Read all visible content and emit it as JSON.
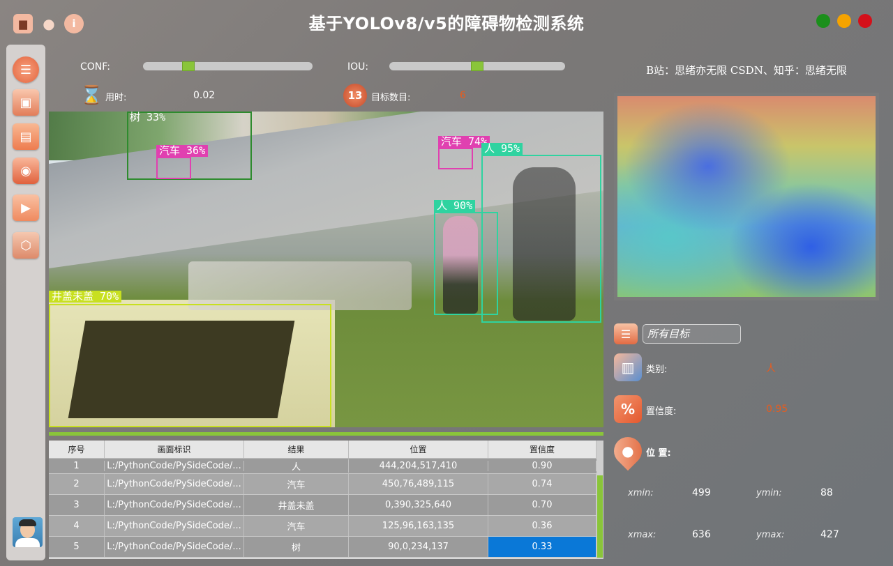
{
  "app": {
    "title": "基于YOLOv8/v5的障碍物检测系统"
  },
  "toolbar": {
    "save_icon": "save-icon",
    "user_icon": "user-icon",
    "info_icon": "info-icon"
  },
  "window_controls": {
    "maximize_color": "#1b8f1b",
    "minimize_color": "#f5a300",
    "close_color": "#d4101a"
  },
  "sidebar": {
    "items": [
      {
        "name": "menu",
        "icon": "list-icon",
        "glyph": "☰"
      },
      {
        "name": "image",
        "icon": "image-icon",
        "glyph": "▣"
      },
      {
        "name": "folder",
        "icon": "folder-icon",
        "glyph": "▤"
      },
      {
        "name": "camera",
        "icon": "camera-icon",
        "glyph": "◉"
      },
      {
        "name": "video",
        "icon": "play-icon",
        "glyph": "▶"
      },
      {
        "name": "model",
        "icon": "cube-icon",
        "glyph": "⬡"
      }
    ]
  },
  "controls": {
    "conf_label": "CONF:",
    "conf_value": 0.25,
    "iou_label": "IOU:",
    "iou_value": 0.5,
    "time_label": "用时:",
    "time_value": "0.02",
    "count_label": "目标数目:",
    "count_value": "6",
    "count_badge": "13"
  },
  "detections": [
    {
      "label": "树 33%",
      "color": "#2e8b2e",
      "text_color": "#ffffff"
    },
    {
      "label": "汽车 36%",
      "color": "#e040b0",
      "text_color": "#ffffff"
    },
    {
      "label": "汽车 74%",
      "color": "#e040b0",
      "text_color": "#ffffff"
    },
    {
      "label": "人 95%",
      "color": "#2fd3a0",
      "text_color": "#ffffff"
    },
    {
      "label": "人 90%",
      "color": "#2fd3a0",
      "text_color": "#ffffff"
    },
    {
      "label": "井盖未盖 70%",
      "color": "#c8e020",
      "text_color": "#ffffff"
    }
  ],
  "table": {
    "headers": [
      "序号",
      "画面标识",
      "结果",
      "位置",
      "置信度"
    ],
    "rows": [
      {
        "id": "1",
        "source": "L:/PythonCode/PySideCode/...",
        "result": "人",
        "position": "444,204,517,410",
        "conf": "0.90"
      },
      {
        "id": "2",
        "source": "L:/PythonCode/PySideCode/...",
        "result": "汽车",
        "position": "450,76,489,115",
        "conf": "0.74"
      },
      {
        "id": "3",
        "source": "L:/PythonCode/PySideCode/...",
        "result": "井盖未盖",
        "position": "0,390,325,640",
        "conf": "0.70"
      },
      {
        "id": "4",
        "source": "L:/PythonCode/PySideCode/...",
        "result": "汽车",
        "position": "125,96,163,135",
        "conf": "0.36"
      },
      {
        "id": "5",
        "source": "L:/PythonCode/PySideCode/...",
        "result": "树",
        "position": "90,0,234,137",
        "conf": "0.33"
      }
    ]
  },
  "right_panel": {
    "credits": "B站：思绪亦无限  CSDN、知乎：思绪无限",
    "filter_placeholder": "所有目标",
    "class_label": "类别:",
    "class_value": "人",
    "conf_label": "置信度:",
    "conf_value": "0.95",
    "pos_label": "位 置:",
    "xmin_label": "xmin:",
    "xmin_value": "499",
    "ymin_label": "ymin:",
    "ymin_value": "88",
    "xmax_label": "xmax:",
    "xmax_value": "636",
    "ymax_label": "ymax:",
    "ymax_value": "427"
  }
}
